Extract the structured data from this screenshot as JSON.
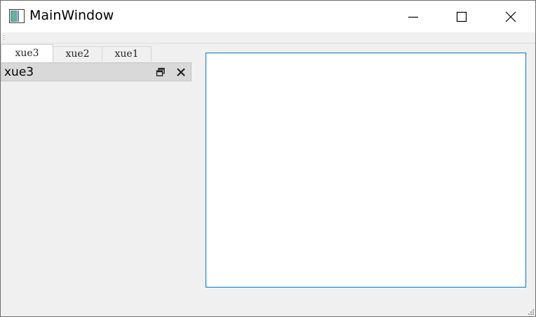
{
  "window": {
    "title": "MainWindow",
    "icon": "qt-app-icon",
    "controls": [
      "minimize-icon",
      "maximize-icon",
      "close-icon"
    ]
  },
  "dock_tabs": [
    {
      "label": "xue3",
      "active": true
    },
    {
      "label": "xue2",
      "active": false
    },
    {
      "label": "xue1",
      "active": false
    }
  ],
  "dock_widget": {
    "title": "xue3",
    "buttons": [
      "float-icon",
      "close-icon"
    ]
  },
  "colors": {
    "accent": "#0078d7",
    "background": "#f0f0f0",
    "titlebar": "#ffffff",
    "dock_title": "#d9d9d9"
  }
}
